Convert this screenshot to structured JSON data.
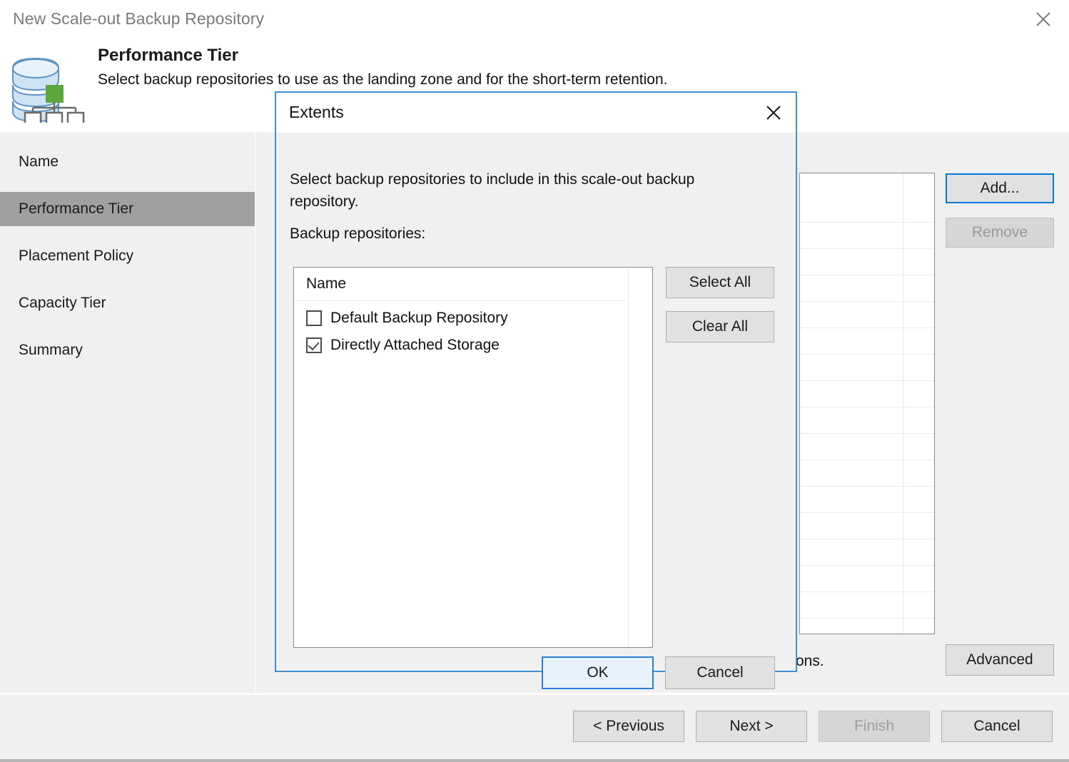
{
  "window": {
    "title": "New Scale-out Backup Repository",
    "close_icon": "close-icon"
  },
  "header": {
    "icon": "scale-out-repository-icon",
    "title": "Performance Tier",
    "subtitle": "Select backup repositories to use as the landing zone and for the short-term retention."
  },
  "sidebar": {
    "items": [
      {
        "label": "Name",
        "selected": false
      },
      {
        "label": "Performance Tier",
        "selected": true
      },
      {
        "label": "Placement Policy",
        "selected": false
      },
      {
        "label": "Capacity Tier",
        "selected": false
      },
      {
        "label": "Summary",
        "selected": false
      }
    ]
  },
  "content": {
    "add_label": "Add...",
    "remove_label": "Remove",
    "advanced_label": "Advanced",
    "hint_text": "ons."
  },
  "modal": {
    "title": "Extents",
    "close_icon": "close-icon",
    "instruction": "Select backup repositories to include in this scale-out backup repository.",
    "repositories_label": "Backup repositories:",
    "list_header": "Name",
    "repositories": [
      {
        "label": "Default Backup Repository",
        "checked": false
      },
      {
        "label": "Directly Attached Storage",
        "checked": true
      }
    ],
    "select_all_label": "Select All",
    "clear_all_label": "Clear All",
    "ok_label": "OK",
    "cancel_label": "Cancel"
  },
  "footer": {
    "previous_label": "< Previous",
    "next_label": "Next >",
    "finish_label": "Finish",
    "cancel_label": "Cancel"
  },
  "colors": {
    "accent": "#0078d7",
    "modal_border": "#3f8fd2",
    "surface": "#f0f0f0",
    "selected_sidebar": "#a0a0a0",
    "icon_green": "#5ca63c",
    "icon_blue": "#c4dcf0"
  }
}
